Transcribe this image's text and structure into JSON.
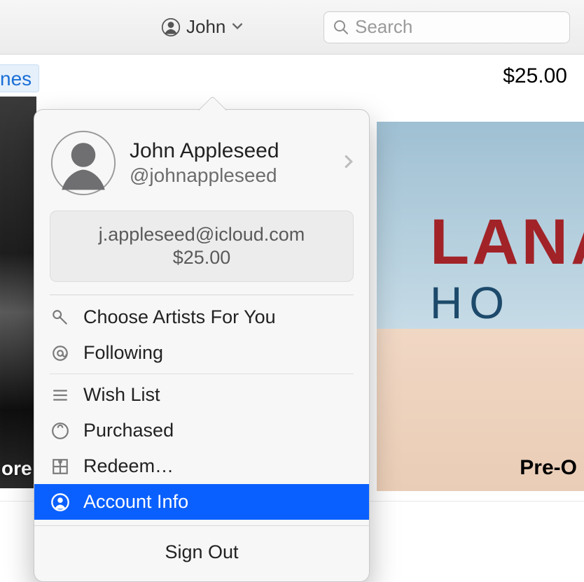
{
  "toolbar": {
    "profile_short_name": "John",
    "search_placeholder": "Search"
  },
  "store": {
    "balance_display": "$25.00",
    "left_tab_fragment": "nes",
    "left_caption_fragment": "ore",
    "album": {
      "title_fragment": "LANA D",
      "subtitle_fragment": "HO",
      "cta_fragment": "Pre-O"
    }
  },
  "popover": {
    "full_name": "John Appleseed",
    "handle": "@johnappleseed",
    "email": "j.appleseed@icloud.com",
    "balance": "$25.00",
    "items": [
      {
        "key": "choose-artists",
        "label": "Choose Artists For You",
        "icon": "microphone-icon"
      },
      {
        "key": "following",
        "label": "Following",
        "icon": "at-sign-icon"
      },
      {
        "key": "wish-list",
        "label": "Wish List",
        "icon": "list-icon"
      },
      {
        "key": "purchased",
        "label": "Purchased",
        "icon": "bag-icon"
      },
      {
        "key": "redeem",
        "label": "Redeem…",
        "icon": "gift-icon"
      },
      {
        "key": "account-info",
        "label": "Account Info",
        "icon": "person-circle-icon",
        "selected": true
      }
    ],
    "sign_out": "Sign Out"
  }
}
